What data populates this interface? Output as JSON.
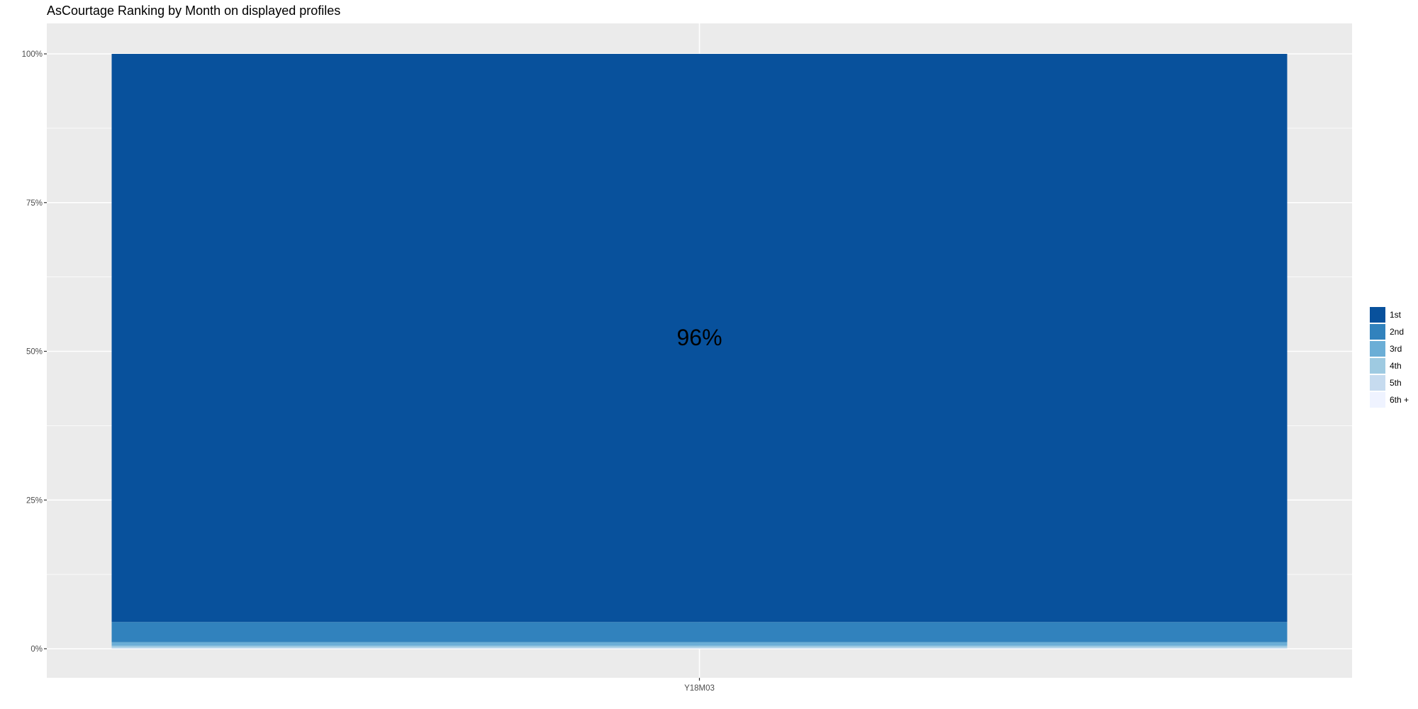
{
  "chart_data": {
    "type": "bar",
    "stacked": true,
    "position": "fill",
    "title": "AsCourtage Ranking by Month on displayed profiles",
    "xlabel": "",
    "ylabel": "",
    "categories": [
      "Y18M03"
    ],
    "ylim": [
      0,
      1
    ],
    "yticks": [
      0,
      0.25,
      0.5,
      0.75,
      1
    ],
    "ytick_labels": [
      "0%",
      "25%",
      "50%",
      "75%",
      "100%"
    ],
    "grid": true,
    "legend_position": "right",
    "series": [
      {
        "name": "1st",
        "color": "#08519c",
        "values": [
          0.955
        ]
      },
      {
        "name": "2nd",
        "color": "#3182bd",
        "values": [
          0.034
        ]
      },
      {
        "name": "3rd",
        "color": "#6baed6",
        "values": [
          0.006
        ]
      },
      {
        "name": "4th",
        "color": "#9ecae1",
        "values": [
          0.003
        ]
      },
      {
        "name": "5th",
        "color": "#c6dbef",
        "values": [
          0.0015
        ]
      },
      {
        "name": "6th +",
        "color": "#eff3ff",
        "values": [
          0.0005
        ]
      }
    ],
    "annotations": [
      {
        "text": "96%",
        "series": "1st",
        "category": "Y18M03",
        "y": 0.52
      }
    ],
    "colors": {
      "panel_background": "#ebebeb",
      "grid": "#ffffff",
      "tick_text": "#4d4d4d"
    }
  }
}
